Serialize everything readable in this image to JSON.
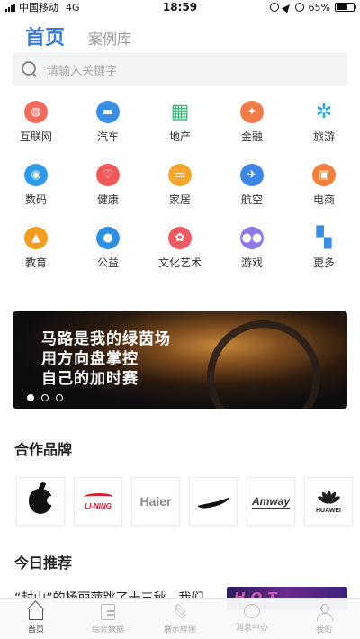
{
  "status_bar": {
    "carrier": "中国移动",
    "network": "4G",
    "time": "18:59",
    "battery": "65%",
    "battery_level": 0.65
  },
  "header": {
    "tab_home": "首页",
    "tab_cases": "案例库"
  },
  "search": {
    "placeholder": "请输入关键字"
  },
  "categories": [
    {
      "label": "互联网",
      "icon": "globe-icon",
      "color": "#f26b5b"
    },
    {
      "label": "汽车",
      "icon": "car-icon",
      "color": "#3a8ee6"
    },
    {
      "label": "地产",
      "icon": "building-icon",
      "color": "#3cb878"
    },
    {
      "label": "金融",
      "icon": "finance-icon",
      "color": "#f07c4a"
    },
    {
      "label": "旅游",
      "icon": "palm-tree-icon",
      "color": "#23a8d9"
    },
    {
      "label": "数码",
      "icon": "camera-icon",
      "color": "#2f9be8"
    },
    {
      "label": "健康",
      "icon": "heart-icon",
      "color": "#ee5a5a"
    },
    {
      "label": "家居",
      "icon": "sofa-icon",
      "color": "#f3a52e"
    },
    {
      "label": "航空",
      "icon": "plane-icon",
      "color": "#3d86e6"
    },
    {
      "label": "电商",
      "icon": "shopping-bag-icon",
      "color": "#f3813b"
    },
    {
      "label": "教育",
      "icon": "graduation-cap-icon",
      "color": "#f39c1f"
    },
    {
      "label": "公益",
      "icon": "drop-icon",
      "color": "#2f8fe0"
    },
    {
      "label": "文化艺术",
      "icon": "palette-icon",
      "color": "#ee5a63"
    },
    {
      "label": "游戏",
      "icon": "gamepad-icon",
      "color": "#8f79e6"
    },
    {
      "label": "更多",
      "icon": "grid-more-icon",
      "color": "#3a8ee6"
    }
  ],
  "banner": {
    "line1": "马路是我的绿茵场",
    "line2": "用方向盘掌控",
    "line3": "自己的加时赛",
    "active_index": 0,
    "total": 3
  },
  "brands": {
    "title": "合作品牌",
    "items": [
      {
        "name": "Apple",
        "logo": "apple-logo"
      },
      {
        "name": "LI-NING",
        "logo": "lining-logo"
      },
      {
        "name": "Haier",
        "logo": "haier-logo"
      },
      {
        "name": "Nike",
        "logo": "nike-logo"
      },
      {
        "name": "Amway",
        "logo": "amway-logo"
      },
      {
        "name": "HUAWEI",
        "logo": "huawei-logo"
      }
    ]
  },
  "recommend": {
    "title": "今日推荐",
    "item_text": "“封山”的杨丽萍跳了十三秋，我们"
  },
  "tabbar": {
    "items": [
      {
        "label": "首页",
        "icon": "home-icon"
      },
      {
        "label": "综合数据",
        "icon": "document-icon"
      },
      {
        "label": "展示样例",
        "icon": "layers-icon"
      },
      {
        "label": "消息中心",
        "icon": "chat-icon"
      },
      {
        "label": "我的",
        "icon": "user-icon"
      }
    ],
    "active_index": 0
  }
}
